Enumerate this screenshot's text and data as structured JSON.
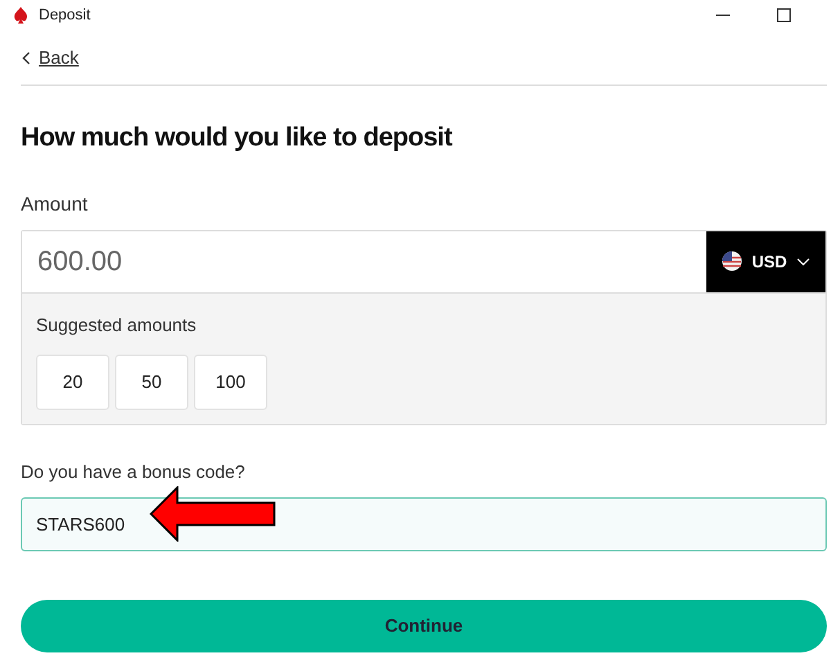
{
  "window": {
    "title": "Deposit"
  },
  "back": "Back",
  "heading": "How much would you like to deposit",
  "amount": {
    "label": "Amount",
    "value": "600.00",
    "currency": "USD"
  },
  "suggested": {
    "label": "Suggested amounts",
    "options": [
      "20",
      "50",
      "100"
    ]
  },
  "bonus": {
    "label": "Do you have a bonus code?",
    "value": "STARS600"
  },
  "continue": "Continue"
}
